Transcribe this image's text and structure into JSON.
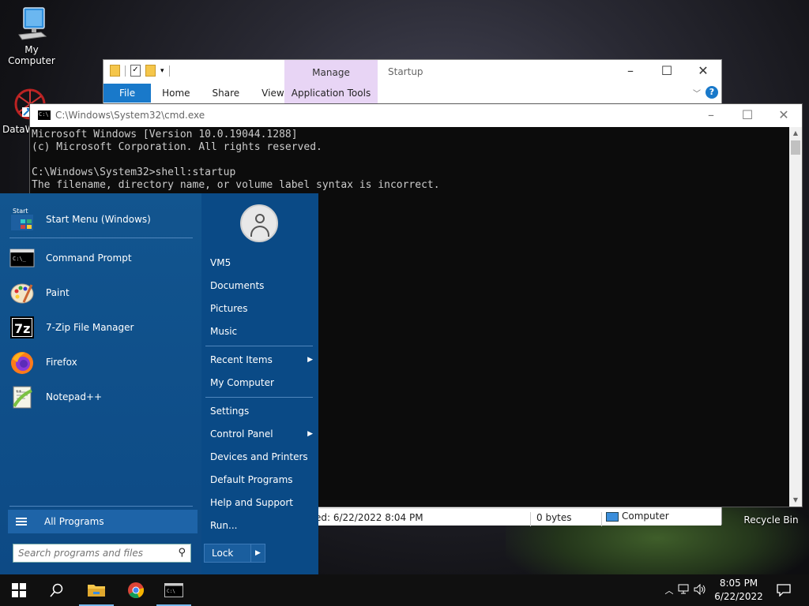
{
  "desktop": {
    "icons": [
      {
        "label": "My Computer"
      },
      {
        "label": "DataW"
      },
      {
        "label": "Recycle Bin"
      }
    ]
  },
  "explorer": {
    "title": "Startup",
    "contextual_group": "Manage",
    "tabs": [
      "File",
      "Home",
      "Share",
      "View"
    ],
    "contextual_tab": "Application Tools",
    "help": "?",
    "status": {
      "date_modified": "ed: 6/22/2022 8:04 PM",
      "size": "0 bytes",
      "location": "Computer"
    }
  },
  "cmd": {
    "title": "C:\\Windows\\System32\\cmd.exe",
    "lines": [
      "Microsoft Windows [Version 10.0.19044.1288]",
      "(c) Microsoft Corporation. All rights reserved.",
      "",
      "C:\\Windows\\System32>shell:startup",
      "The filename, directory name, or volume label syntax is incorrect."
    ]
  },
  "start_menu": {
    "programs": [
      {
        "label": "Start Menu (Windows)",
        "icon": "start-menu-icon"
      },
      {
        "label": "Command Prompt",
        "icon": "command-prompt-icon"
      },
      {
        "label": "Paint",
        "icon": "paint-icon"
      },
      {
        "label": "7-Zip File Manager",
        "icon": "7zip-icon"
      },
      {
        "label": "Firefox",
        "icon": "firefox-icon"
      },
      {
        "label": "Notepad++",
        "icon": "notepadpp-icon"
      }
    ],
    "start_icon_text": "Start",
    "all_programs": "All Programs",
    "search_placeholder": "Search programs and files",
    "right_items": {
      "user": "VM5",
      "documents": "Documents",
      "pictures": "Pictures",
      "music": "Music",
      "recent_items": "Recent Items",
      "my_computer": "My Computer",
      "settings": "Settings",
      "control_panel": "Control Panel",
      "devices_printers": "Devices and Printers",
      "default_programs": "Default Programs",
      "help_support": "Help and Support",
      "run": "Run..."
    },
    "lock": "Lock"
  },
  "taskbar": {
    "time": "8:05 PM",
    "date": "6/22/2022"
  },
  "colors": {
    "start_menu_bg": "#0e4d8e",
    "ribbon_file": "#1979ca",
    "manage_tab": "#e8d5f5",
    "cmd_text": "#cccccc",
    "taskbar_bg": "#101010"
  }
}
